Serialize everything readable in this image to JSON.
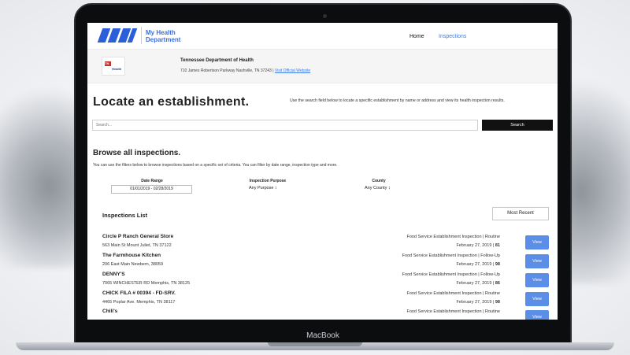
{
  "device": {
    "brand": "MacBook"
  },
  "header": {
    "app_title_line1": "My Health",
    "app_title_line2": "Department",
    "nav": {
      "home": "Home",
      "inspections": "Inspections"
    }
  },
  "agency": {
    "logo_tn": "TN",
    "logo_health": "Health",
    "name": "Tennessee Department of Health",
    "address": "710 James Robertson Parkway Nashville, TN 37243 |",
    "link": "Visit Official Website"
  },
  "locate": {
    "title": "Locate an establishment.",
    "description": "Use the search field below to locate a specific establishment by name or address and view its health inspection results.",
    "search_placeholder": "Search...",
    "search_button": "Search"
  },
  "browse": {
    "title": "Browse all inspections.",
    "description": "You can use the filters below to browse inspections based on a specific set of criteria. You can filter by date range, inspection type and more.",
    "date_label": "Date Range",
    "date_value": "01/01/2019 - 02/28/2019",
    "purpose_label": "Inspection Purpose",
    "purpose_value": "Any Purpose ↕",
    "county_label": "County",
    "county_value": "Any County ↕"
  },
  "list": {
    "title": "Inspections List",
    "sort": "Most Recent",
    "view_label": "View",
    "rows": [
      {
        "name": "Circle P Ranch General Store",
        "address": "563 Main St Mount Juliet, TN 37122",
        "type": "Food Service Establishment Inspection | Routine",
        "date": "February 27, 2019 |",
        "score": "81"
      },
      {
        "name": "The Farmhouse Kitchen",
        "address": "206 East Main Newbern, 38059",
        "type": "Food Service Establishment Inspection | Follow-Up",
        "date": "February 27, 2019 |",
        "score": "98"
      },
      {
        "name": "DENNY'S",
        "address": "7065 WINCHESTER RD Memphis, TN 38125",
        "type": "Food Service Establishment Inspection | Follow-Up",
        "date": "February 27, 2019 |",
        "score": "86"
      },
      {
        "name": "CHICK FILA # 00394 - FD-SRV.",
        "address": "4465 Poplar Ave. Memphis, TN 38117",
        "type": "Food Service Establishment Inspection | Routine",
        "date": "February 27, 2019 |",
        "score": "98"
      },
      {
        "name": "Chili's",
        "address": "",
        "type": "Food Service Establishment Inspection | Routine",
        "date": "",
        "score": ""
      }
    ]
  }
}
